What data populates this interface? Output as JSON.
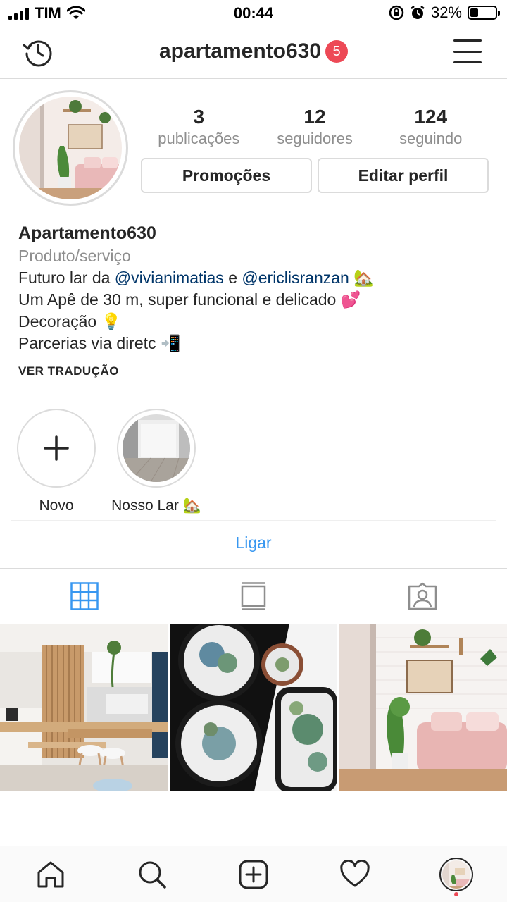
{
  "status_bar": {
    "carrier": "TIM",
    "time": "00:44",
    "battery": "32%",
    "battery_level": 0.32
  },
  "header": {
    "username": "apartamento630",
    "notification_count": "5",
    "icons": [
      "history-icon",
      "menu-icon"
    ]
  },
  "profile": {
    "stats": [
      {
        "value": "3",
        "label": "publicações"
      },
      {
        "value": "12",
        "label": "seguidores"
      },
      {
        "value": "124",
        "label": "seguindo"
      }
    ],
    "buttons": {
      "promotions": "Promoções",
      "edit_profile": "Editar perfil"
    },
    "name": "Apartamento630",
    "category": "Produto/serviço",
    "bio": {
      "line1_prefix": "Futuro lar da ",
      "mention1": "@vivianimatias",
      "line1_mid": " e ",
      "mention2": "@ericlisranzan",
      "line1_emoji": "🏡",
      "line2": "Um Apê de 30 m, super funcional e delicado 💕",
      "line3": "Decoração 💡",
      "line4": "Parcerias via diretc 📲"
    },
    "see_translation": "VER TRADUÇÃO"
  },
  "highlights": [
    {
      "label": "Novo",
      "icon": "plus-icon"
    },
    {
      "label": "Nosso Lar 🏡"
    }
  ],
  "call_button": "Ligar",
  "tabs": [
    {
      "icon": "grid-icon",
      "active": true
    },
    {
      "icon": "feed-icon",
      "active": false
    },
    {
      "icon": "tagged-icon",
      "active": false
    }
  ],
  "bottom_nav": [
    "home-icon",
    "search-icon",
    "add-post-icon",
    "activity-heart-icon",
    "profile-avatar"
  ],
  "colors": {
    "accent_blue": "#3897f0",
    "badge_red": "#ed4956",
    "mention": "#003569",
    "muted": "#8e8e8e",
    "border": "#dbdbdb"
  }
}
